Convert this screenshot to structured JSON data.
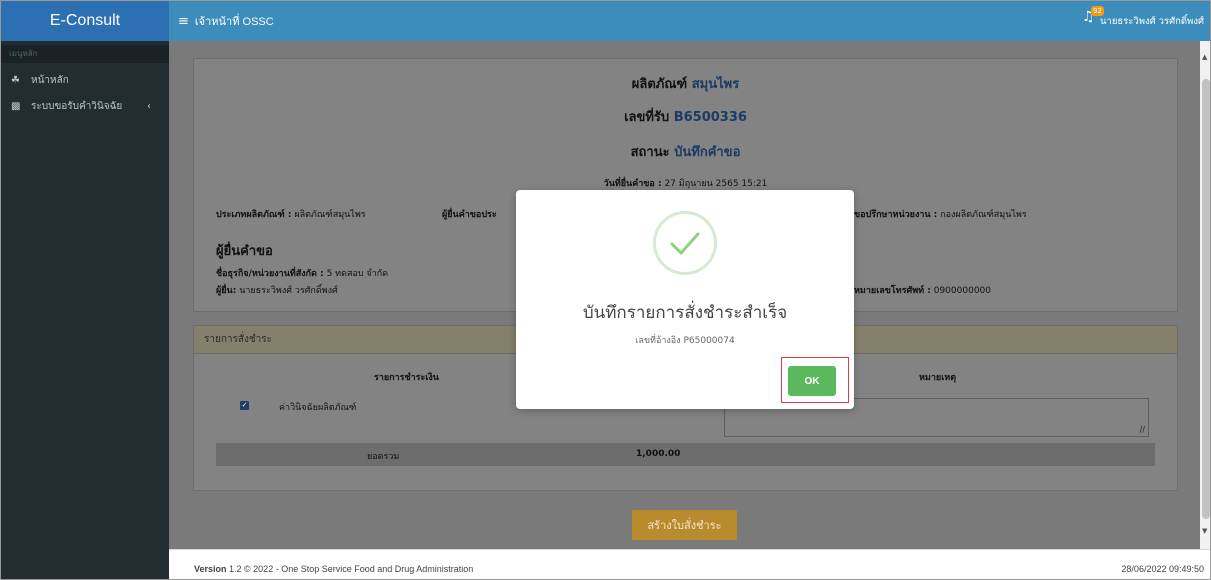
{
  "app": {
    "brand": "E-Consult"
  },
  "header": {
    "title": "เจ้าหน้าที่ OSSC",
    "notification_count": "92",
    "user_name": "นายธระวิพงศ์ วรศักดิ์พงศ์"
  },
  "sidebar": {
    "section_label": "เมนูหลัก",
    "items": [
      {
        "label": "หน้าหลัก",
        "icon": "home-icon"
      },
      {
        "label": "ระบบขอรับคำวินิจฉัย",
        "icon": "book-icon"
      }
    ]
  },
  "request": {
    "product_label": "ผลิตภัณฑ์",
    "product_value": "สมุนไพร",
    "receipt_label": "เลขที่รับ",
    "receipt_value": "B6500336",
    "status_label": "สถานะ",
    "status_value": "บันทึกคำขอ",
    "date_label": "วันที่ยื่นคำขอ :",
    "date_value": "27 มิถุนายน 2565 15:21",
    "product_type_label": "ประเภทผลิตภัณฑ์ :",
    "product_type_value": "ผลิตภัณฑ์สมุนไพร",
    "officer_label": "ผู้ยื่นคำขอประ",
    "consult_unit_label": "ขอปรึกษาหน่วยงาน :",
    "consult_unit_value": "กองผลิตภัณฑ์สมุนไพร",
    "applicant_heading": "ผู้ยื่นคำขอ",
    "business_label": "ชื่อธุรกิจ/หน่วยงานที่สังกัด :",
    "business_value": "5 ทดสอบ จำกัด",
    "applicant_label": "ผู้ยื่น:",
    "applicant_value": "นายธระวิพงศ์ วรศักดิ์พงศ์",
    "phone_label": "หมายเลขโทรศัพท์ :",
    "phone_value": "0900000000"
  },
  "payment": {
    "section_title": "รายการสั่งชำระ",
    "col_item": "รายการชำระเงิน",
    "col_remark": "หมายเหตุ",
    "items": [
      {
        "label": "ค่าวินิจฉัยผลิตภัณฑ์",
        "checked": true
      }
    ],
    "total_label": "ยอดรวม",
    "total_value": "1,000.00",
    "create_button": "สร้างใบสั่งชำระ"
  },
  "footer": {
    "version_label": "Version",
    "version_text": "1.2 © 2022 - One Stop Service Food and Drug Administration",
    "timestamp": "28/06/2022 09:49:50"
  },
  "modal": {
    "title": "บันทึกรายการสั่งชำระสำเร็จ",
    "reference": "เลขที่อ้างอิง P65000074",
    "ok_label": "OK",
    "success_color": "#5bb85c"
  }
}
